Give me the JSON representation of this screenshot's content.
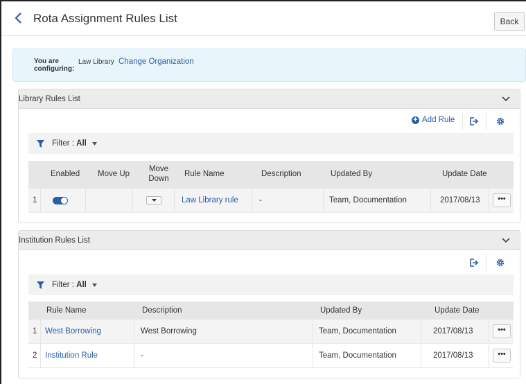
{
  "header": {
    "title": "Rota Assignment Rules List",
    "back_label": "Back"
  },
  "config": {
    "label": "You are configuring:",
    "organization": "Law Library",
    "change_label": "Change Organization"
  },
  "library_panel": {
    "title": "Library Rules List",
    "add_rule_label": "Add Rule",
    "filter_label": "Filter :",
    "filter_value": "All",
    "columns": {
      "enabled": "Enabled",
      "move_up": "Move Up",
      "move_down": "Move Down",
      "rule_name": "Rule Name",
      "description": "Description",
      "updated_by": "Updated By",
      "update_date": "Update Date"
    },
    "rows": [
      {
        "index": "1",
        "enabled": true,
        "rule_name": "Law Library rule",
        "description": "-",
        "updated_by": "Team, Documentation",
        "update_date": "2017/08/13",
        "more": "•••"
      }
    ]
  },
  "institution_panel": {
    "title": "Institution Rules List",
    "filter_label": "Filter :",
    "filter_value": "All",
    "columns": {
      "rule_name": "Rule Name",
      "description": "Description",
      "updated_by": "Updated By",
      "update_date": "Update Date"
    },
    "rows": [
      {
        "index": "1",
        "rule_name": "West Borrowing",
        "description": "West Borrowing",
        "updated_by": "Team, Documentation",
        "update_date": "2017/08/13",
        "more": "•••"
      },
      {
        "index": "2",
        "rule_name": "Institution Rule",
        "description": "-",
        "updated_by": "Team, Documentation",
        "update_date": "2017/08/13",
        "more": "•••"
      }
    ]
  },
  "colors": {
    "link": "#2a5fa5",
    "banner_bg": "#e8f6fc",
    "header_bg": "#ececec"
  }
}
